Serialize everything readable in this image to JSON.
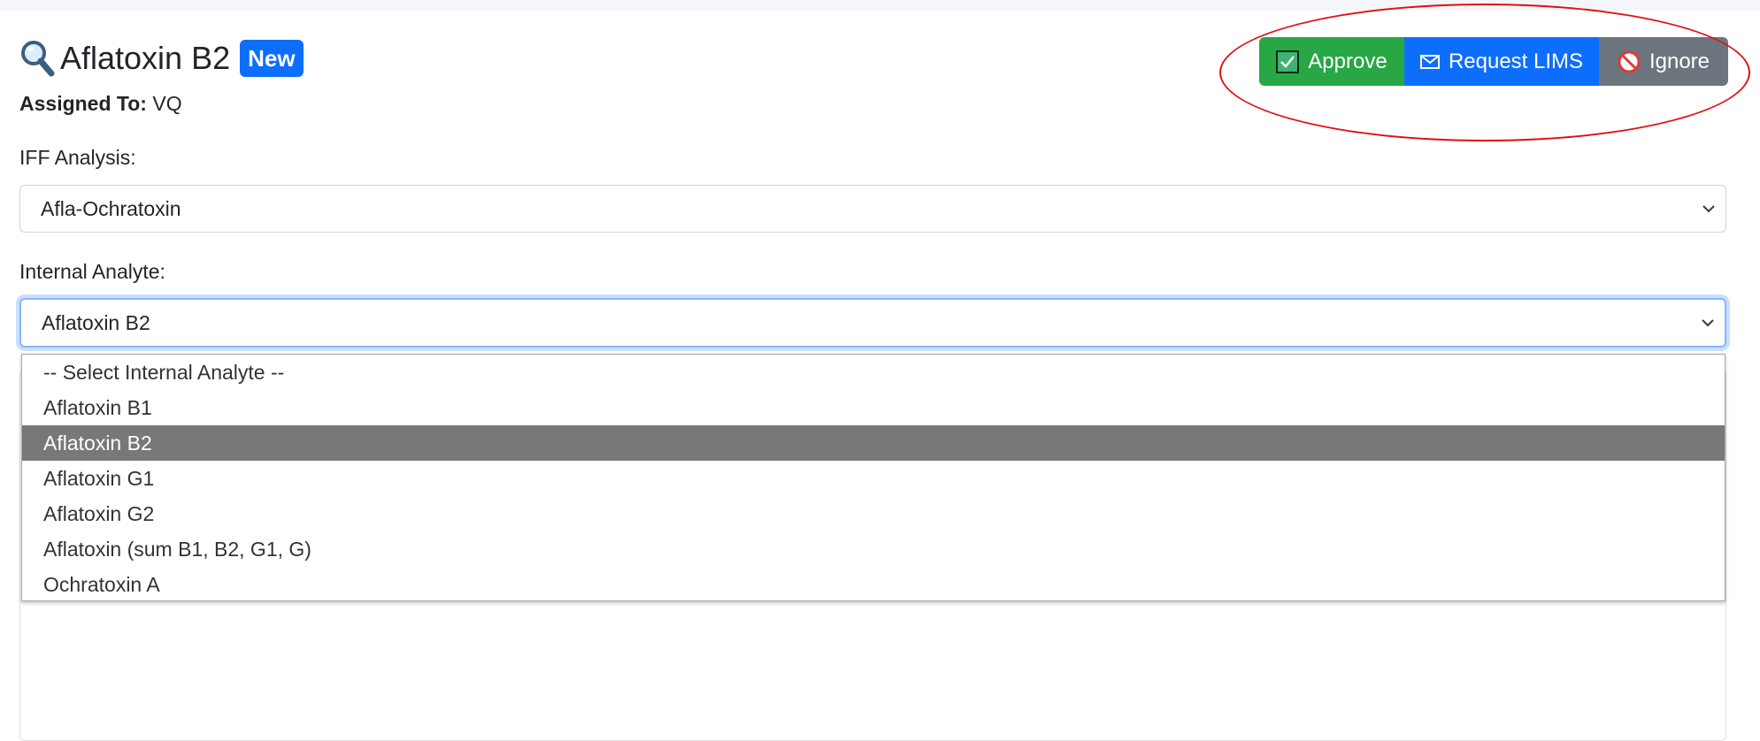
{
  "header": {
    "title": "Aflatoxin B2",
    "badge": "New",
    "assigned_label": "Assigned To:",
    "assigned_value": "VQ"
  },
  "actions": {
    "approve_label": "Approve",
    "request_lims_label": "Request LIMS",
    "ignore_label": "Ignore"
  },
  "form": {
    "iff_analysis_label": "IFF Analysis:",
    "iff_analysis_value": "Afla-Ochratoxin",
    "internal_analyte_label": "Internal Analyte:",
    "internal_analyte_value": "Aflatoxin B2",
    "internal_analyte_options": [
      "-- Select Internal Analyte --",
      "Aflatoxin B1",
      "Aflatoxin B2",
      "Aflatoxin G1",
      "Aflatoxin G2",
      "Aflatoxin (sum B1, B2, G1, G)",
      "Ochratoxin A"
    ],
    "selected_index": 2
  },
  "icons": {
    "title_icon": "magnifying-glass-icon",
    "approve_icon": "check-box-icon",
    "lims_icon": "envelope-icon",
    "ignore_icon": "prohibited-icon",
    "chevron": "chevron-down-icon"
  },
  "colors": {
    "approve": "#28a745",
    "request_lims": "#0d6efd",
    "ignore": "#6c757d",
    "badge": "#0d6efd",
    "annotation": "#e01010",
    "selected_option": "#787878"
  }
}
